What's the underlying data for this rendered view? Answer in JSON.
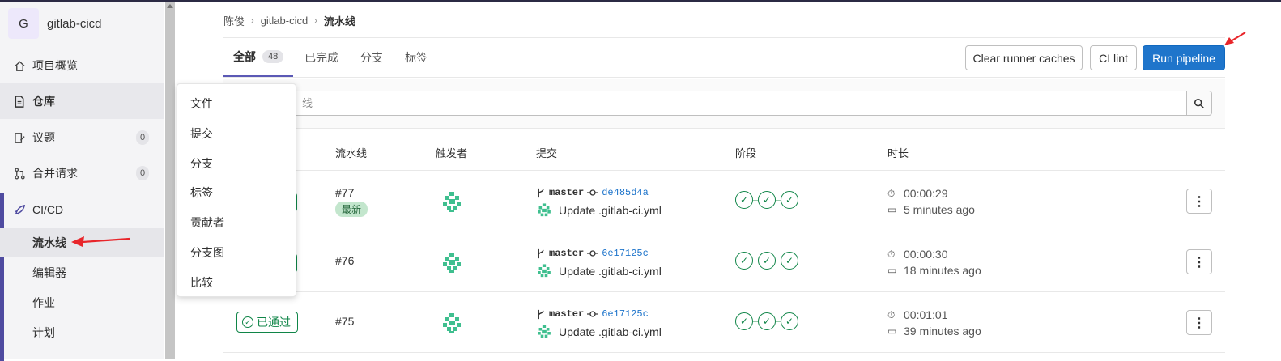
{
  "sidebar": {
    "project_avatar": "G",
    "project_name": "gitlab-cicd",
    "items": [
      {
        "label": "项目概览",
        "icon": "home-icon"
      },
      {
        "label": "仓库",
        "icon": "document-icon"
      },
      {
        "label": "议题",
        "icon": "issues-icon",
        "count": "0"
      },
      {
        "label": "合并请求",
        "icon": "merge-request-icon",
        "count": "0"
      },
      {
        "label": "CI/CD",
        "icon": "rocket-icon"
      }
    ],
    "cicd_sub": [
      "流水线",
      "编辑器",
      "作业",
      "计划"
    ]
  },
  "flyout": {
    "items": [
      "文件",
      "提交",
      "分支",
      "标签",
      "贡献者",
      "分支图",
      "比较"
    ]
  },
  "breadcrumb": {
    "items": [
      "陈俊",
      "gitlab-cicd",
      "流水线"
    ]
  },
  "tabs": [
    {
      "label": "全部",
      "count": "48"
    },
    {
      "label": "已完成"
    },
    {
      "label": "分支"
    },
    {
      "label": "标签"
    }
  ],
  "buttons": {
    "clear_cache": "Clear runner caches",
    "ci_lint": "CI lint",
    "run_pipeline": "Run pipeline"
  },
  "search": {
    "placeholder_visible": "线"
  },
  "table": {
    "headers": [
      "流水线",
      "触发者",
      "提交",
      "阶段",
      "时长"
    ],
    "rows": [
      {
        "status": "",
        "id": "#77",
        "latest": "最新",
        "ref": "master",
        "sha": "de485d4a",
        "message": "Update .gitlab-ci.yml",
        "duration": "00:00:29",
        "finished": "5 minutes ago"
      },
      {
        "status": "",
        "id": "#76",
        "latest": "",
        "ref": "master",
        "sha": "6e17125c",
        "message": "Update .gitlab-ci.yml",
        "duration": "00:00:30",
        "finished": "18 minutes ago"
      },
      {
        "status": "已通过",
        "id": "#75",
        "latest": "",
        "ref": "master",
        "sha": "6e17125c",
        "message": "Update .gitlab-ci.yml",
        "duration": "00:01:01",
        "finished": "39 minutes ago"
      }
    ]
  },
  "colors": {
    "primary": "#1f75cb",
    "success": "#108548",
    "annotation_arrow": "#e8252a",
    "sidebar_accent": "#4f4ba0"
  }
}
